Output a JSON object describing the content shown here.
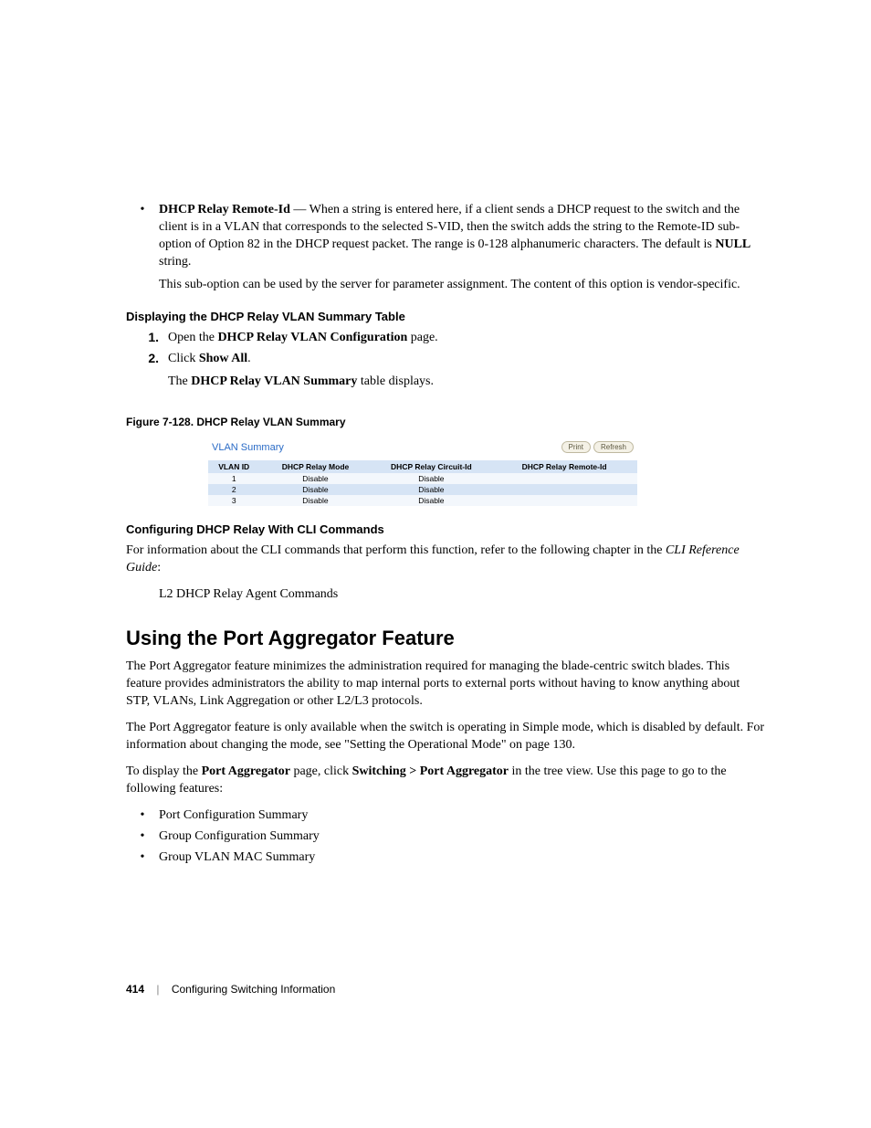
{
  "bullet1": {
    "label": "DHCP Relay Remote-Id",
    "text": " — When a string is entered here, if a client sends a DHCP request to the switch and the client is in a VLAN that corresponds to the selected S-VID, then the switch adds the string to the Remote-ID sub-option of Option 82 in the DHCP request packet. The range is 0-128 alphanumeric characters. The default is ",
    "null": "NULL",
    "tail": " string.",
    "sub": "This sub-option can be used by the server for parameter assignment. The content of this option is vendor-specific."
  },
  "h4a": "Displaying the DHCP Relay VLAN Summary Table",
  "steps": {
    "s1_pre": "Open the ",
    "s1_b": "DHCP Relay VLAN Configuration",
    "s1_post": " page.",
    "s2_pre": "Click ",
    "s2_b": "Show All",
    "s2_post": ".",
    "s2_sub_pre": "The ",
    "s2_sub_b": "DHCP Relay VLAN Summary",
    "s2_sub_post": " table displays."
  },
  "figcap": "Figure 7-128.    DHCP Relay VLAN Summary",
  "fig": {
    "title": "VLAN Summary",
    "btn_print": "Print",
    "btn_refresh": "Refresh",
    "headers": [
      "VLAN ID",
      "DHCP Relay Mode",
      "DHCP Relay Circuit-Id",
      "DHCP Relay Remote-Id"
    ]
  },
  "chart_data": {
    "type": "table",
    "title": "VLAN Summary",
    "columns": [
      "VLAN ID",
      "DHCP Relay Mode",
      "DHCP Relay Circuit-Id",
      "DHCP Relay Remote-Id"
    ],
    "rows": [
      [
        "1",
        "Disable",
        "Disable",
        ""
      ],
      [
        "2",
        "Disable",
        "Disable",
        ""
      ],
      [
        "3",
        "Disable",
        "Disable",
        ""
      ]
    ]
  },
  "h4b": "Configuring DHCP Relay With CLI Commands",
  "cli_p_pre": "For information about the CLI commands that perform this function, refer to the following chapter in the ",
  "cli_p_i": "CLI Reference Guide",
  "cli_p_post": ":",
  "cli_item": "L2 DHCP Relay Agent Commands",
  "h2": "Using the Port Aggregator Feature",
  "pa_p1": "The Port Aggregator feature minimizes the administration required for managing the blade-centric switch blades. This feature provides administrators the ability to map internal ports to external ports without having to know anything about STP, VLANs, Link Aggregation or other L2/L3 protocols.",
  "pa_p2": "The Port Aggregator feature is only available when the switch is operating in Simple mode, which is disabled by default. For information about changing the mode, see \"Setting the Operational Mode\" on page 130.",
  "pa_p3_pre": "To display the ",
  "pa_p3_b1": "Port Aggregator",
  "pa_p3_mid": " page, click ",
  "pa_p3_b2": "Switching > Port Aggregator",
  "pa_p3_post": " in the tree view. Use this page to go to the following features:",
  "feat": [
    "Port Configuration Summary",
    "Group Configuration Summary",
    "Group VLAN MAC Summary"
  ],
  "footer": {
    "page": "414",
    "section": "Configuring Switching Information"
  }
}
